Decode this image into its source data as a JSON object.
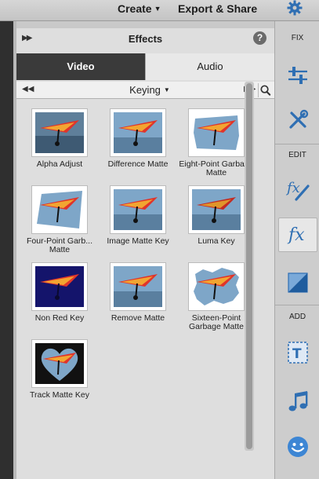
{
  "topbar": {
    "create_label": "Create",
    "export_label": "Export & Share"
  },
  "panel": {
    "title": "Effects",
    "help_glyph": "?",
    "tabs": [
      {
        "label": "Video",
        "selected": true
      },
      {
        "label": "Audio",
        "selected": false
      }
    ],
    "category": "Keying"
  },
  "effects": [
    {
      "label": "Alpha Adjust",
      "icon": "alpha-adjust-thumb"
    },
    {
      "label": "Difference Matte",
      "icon": "difference-matte-thumb"
    },
    {
      "label": "Eight-Point Garbage Matte",
      "icon": "eight-point-garbage-matte-thumb"
    },
    {
      "label": "Four-Point Garb... Matte",
      "icon": "four-point-garbage-matte-thumb"
    },
    {
      "label": "Image Matte Key",
      "icon": "image-matte-key-thumb"
    },
    {
      "label": "Luma Key",
      "icon": "luma-key-thumb"
    },
    {
      "label": "Non Red Key",
      "icon": "non-red-key-thumb"
    },
    {
      "label": "Remove Matte",
      "icon": "remove-matte-thumb"
    },
    {
      "label": "Sixteen-Point Garbage Matte",
      "icon": "sixteen-point-garbage-matte-thumb"
    },
    {
      "label": "Track Matte Key",
      "icon": "track-matte-key-thumb"
    }
  ],
  "rightbar": {
    "fix_label": "FIX",
    "edit_label": "EDIT",
    "add_label": "ADD",
    "active_tool": "effects"
  },
  "colors": {
    "accent": "#3d7fc0",
    "active_tab": "#3a3a3a"
  }
}
